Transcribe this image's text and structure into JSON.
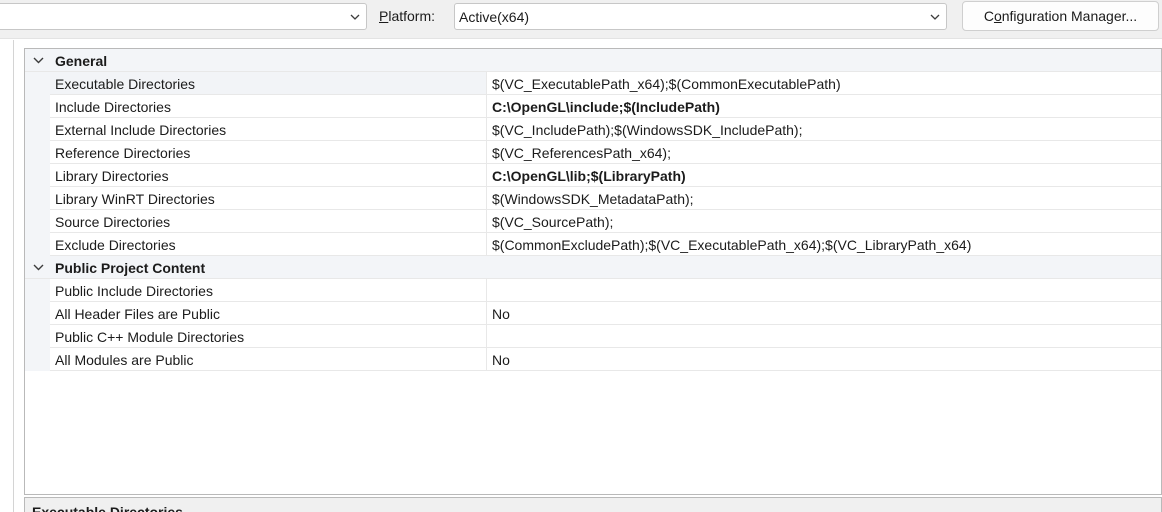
{
  "toolbar": {
    "configuration_value": "",
    "platform_label_u": "P",
    "platform_label_rest": "latform:",
    "platform_value": "Active(x64)",
    "config_manager_u": "o",
    "config_manager_pre": "C",
    "config_manager_rest": "nfiguration Manager..."
  },
  "grid": {
    "categories": [
      {
        "label": "General",
        "rows": [
          {
            "name": "Executable Directories",
            "value": "$(VC_ExecutablePath_x64);$(CommonExecutablePath)",
            "bold": false
          },
          {
            "name": "Include Directories",
            "value": "C:\\OpenGL\\include;$(IncludePath)",
            "bold": true
          },
          {
            "name": "External Include Directories",
            "value": "$(VC_IncludePath);$(WindowsSDK_IncludePath);",
            "bold": false
          },
          {
            "name": "Reference Directories",
            "value": "$(VC_ReferencesPath_x64);",
            "bold": false
          },
          {
            "name": "Library Directories",
            "value": "C:\\OpenGL\\lib;$(LibraryPath)",
            "bold": true
          },
          {
            "name": "Library WinRT Directories",
            "value": "$(WindowsSDK_MetadataPath);",
            "bold": false
          },
          {
            "name": "Source Directories",
            "value": "$(VC_SourcePath);",
            "bold": false
          },
          {
            "name": "Exclude Directories",
            "value": "$(CommonExcludePath);$(VC_ExecutablePath_x64);$(VC_LibraryPath_x64)",
            "bold": false
          }
        ]
      },
      {
        "label": "Public Project Content",
        "rows": [
          {
            "name": "Public Include Directories",
            "value": "",
            "bold": false
          },
          {
            "name": "All Header Files are Public",
            "value": "No",
            "bold": false
          },
          {
            "name": "Public C++ Module Directories",
            "value": "",
            "bold": false
          },
          {
            "name": "All Modules are Public",
            "value": "No",
            "bold": false
          }
        ]
      }
    ]
  },
  "description": {
    "title": "Executable Directories"
  }
}
